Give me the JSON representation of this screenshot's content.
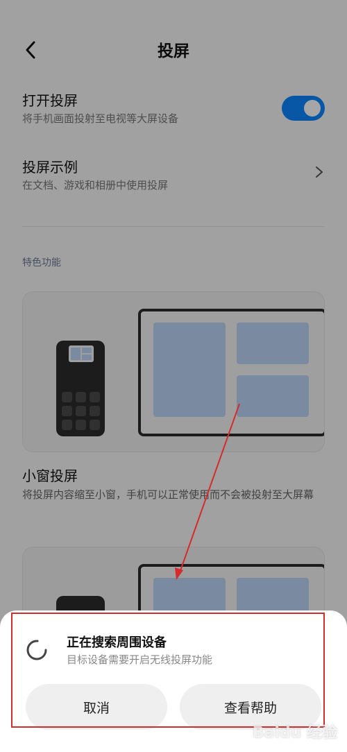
{
  "header": {
    "title": "投屏",
    "back_icon": "chevron-left-icon"
  },
  "settings": {
    "cast": {
      "title": "打开投屏",
      "subtitle": "将手机画面投射至电视等大屏设备",
      "enabled": true
    },
    "examples": {
      "title": "投屏示例",
      "subtitle": "在文档、游戏和相册中使用投屏"
    }
  },
  "section": {
    "label": "特色功能"
  },
  "feature": {
    "title": "小窗投屏",
    "description": "将投屏内容缩至小窗，手机可以正常使用而不会被投射至大屏幕"
  },
  "sheet": {
    "title": "正在搜索周围设备",
    "subtitle": "目标设备需要开启无线投屏功能",
    "cancel_label": "取消",
    "help_label": "查看帮助"
  },
  "colors": {
    "accent": "#0d84ff",
    "annotation": "#d62b2b",
    "pane": "#bcd4f8"
  },
  "watermark": "Baidu 经验"
}
